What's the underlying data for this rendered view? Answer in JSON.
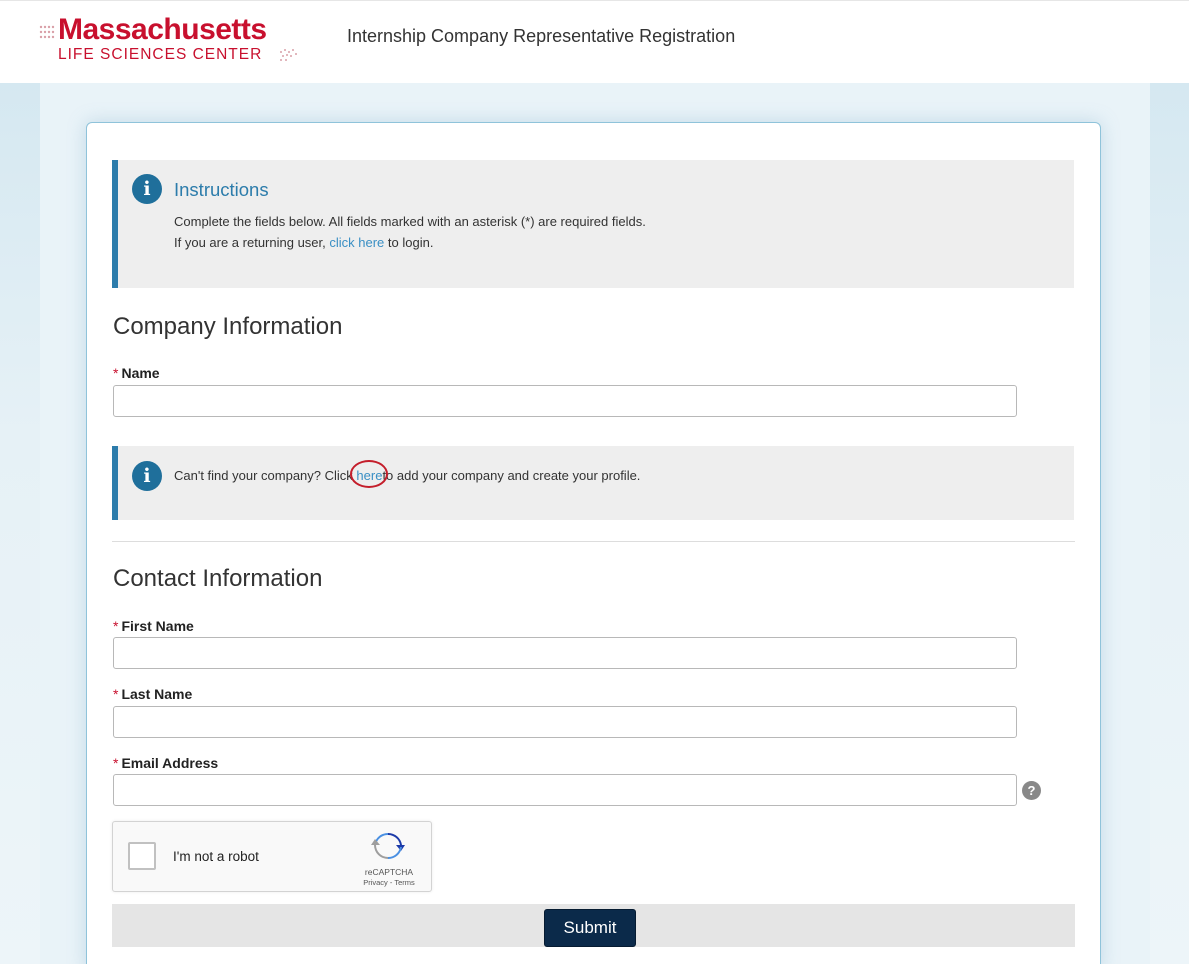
{
  "header": {
    "logo_main": "Massachusetts",
    "logo_sub": "LIFE SCIENCES CENTER",
    "title": "Internship Company Representative Registration"
  },
  "instructions": {
    "title": "Instructions",
    "line1": "Complete the fields below. All fields marked with an asterisk (*) are required fields.",
    "line2_prefix": "If you are a returning user, ",
    "line2_link": "click here",
    "line2_suffix": " to login."
  },
  "company_section": {
    "heading": "Company Information",
    "name_label": "Name",
    "name_value": "",
    "notice_prefix": "Can't find your company? Click ",
    "notice_link": "here",
    "notice_suffix": "to add your company and create your profile."
  },
  "contact_section": {
    "heading": "Contact Information",
    "first_name_label": "First Name",
    "first_name_value": "",
    "last_name_label": "Last Name",
    "last_name_value": "",
    "email_label": "Email Address",
    "email_value": ""
  },
  "required_marker": "*",
  "help_icon_glyph": "?",
  "captcha": {
    "label": "I'm not a robot",
    "brand": "reCAPTCHA",
    "links": "Privacy - Terms"
  },
  "submit_label": "Submit",
  "colors": {
    "brand_red": "#c8102e",
    "accent_blue": "#2c7cab",
    "submit_navy": "#0b2a4a"
  }
}
